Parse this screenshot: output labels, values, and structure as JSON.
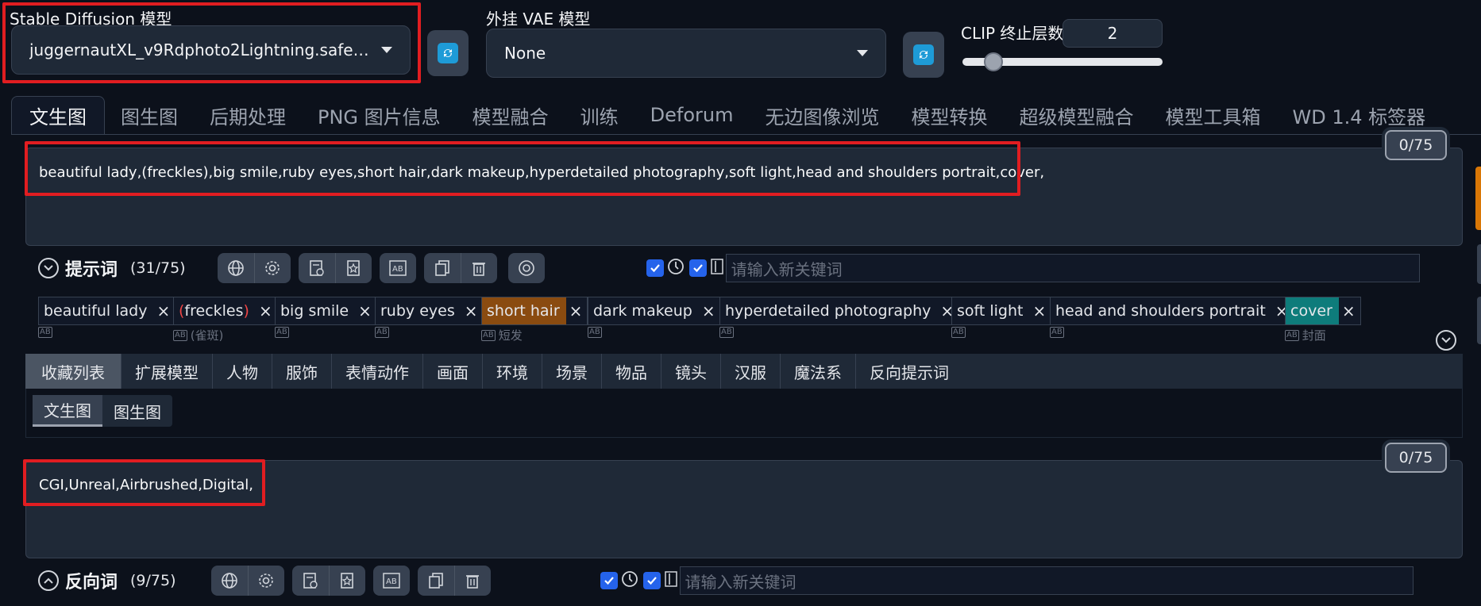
{
  "model_bar": {
    "sd_model_label": "Stable Diffusion 模型",
    "sd_model_value": "juggernautXL_v9Rdphoto2Lightning.safetensors",
    "vae_label": "外挂 VAE 模型",
    "vae_value": "None",
    "clip_label": "CLIP 终止层数",
    "clip_value": "2",
    "clip_level": 0.12
  },
  "tabs": [
    {
      "label": "文生图"
    },
    {
      "label": "图生图"
    },
    {
      "label": "后期处理"
    },
    {
      "label": "PNG 图片信息"
    },
    {
      "label": "模型融合"
    },
    {
      "label": "训练"
    },
    {
      "label": "Deforum"
    },
    {
      "label": "无边图像浏览"
    },
    {
      "label": "模型转换"
    },
    {
      "label": "超级模型融合"
    },
    {
      "label": "模型工具箱"
    },
    {
      "label": "WD 1.4 标签器"
    }
  ],
  "positive": {
    "text": "beautiful lady,(freckles),big smile,ruby eyes,short hair,dark makeup,hyperdetailed photography,soft light,head and shoulders portrait,cover,",
    "counter": "0/75",
    "label": "提示词",
    "count": "(31/75)",
    "keyword_placeholder": "请输入新关键词",
    "tags": [
      {
        "text": "beautiful lady",
        "sub": ""
      },
      {
        "text_pre": "(",
        "text_mid": "freckles",
        "text_post": ")",
        "sub": "(雀斑)"
      },
      {
        "text": "big smile",
        "sub": ""
      },
      {
        "text": "ruby eyes",
        "sub": ""
      },
      {
        "text": "short hair",
        "sub": "短发"
      },
      {
        "text": "dark makeup",
        "sub": ""
      },
      {
        "text": "hyperdetailed photography",
        "sub": ""
      },
      {
        "text": "soft light",
        "sub": ""
      },
      {
        "text": "head and shoulders portrait",
        "sub": ""
      },
      {
        "text": "cover",
        "sub": "封面"
      }
    ]
  },
  "categories": [
    {
      "label": "收藏列表"
    },
    {
      "label": "扩展模型"
    },
    {
      "label": "人物"
    },
    {
      "label": "服饰"
    },
    {
      "label": "表情动作"
    },
    {
      "label": "画面"
    },
    {
      "label": "环境"
    },
    {
      "label": "场景"
    },
    {
      "label": "物品"
    },
    {
      "label": "镜头"
    },
    {
      "label": "汉服"
    },
    {
      "label": "魔法系"
    },
    {
      "label": "反向提示词"
    }
  ],
  "sub_tabs": [
    {
      "label": "文生图"
    },
    {
      "label": "图生图"
    }
  ],
  "negative": {
    "text": "CGI,Unreal,Airbrushed,Digital,",
    "counter": "0/75",
    "label": "反向词",
    "count": "(9/75)",
    "keyword_placeholder": "请输入新关键词"
  },
  "colors": {
    "accent": "#2563eb",
    "highlight_red": "#e11d21",
    "tag_orange": "#8a4b10",
    "tag_teal": "#0e7c7b"
  }
}
